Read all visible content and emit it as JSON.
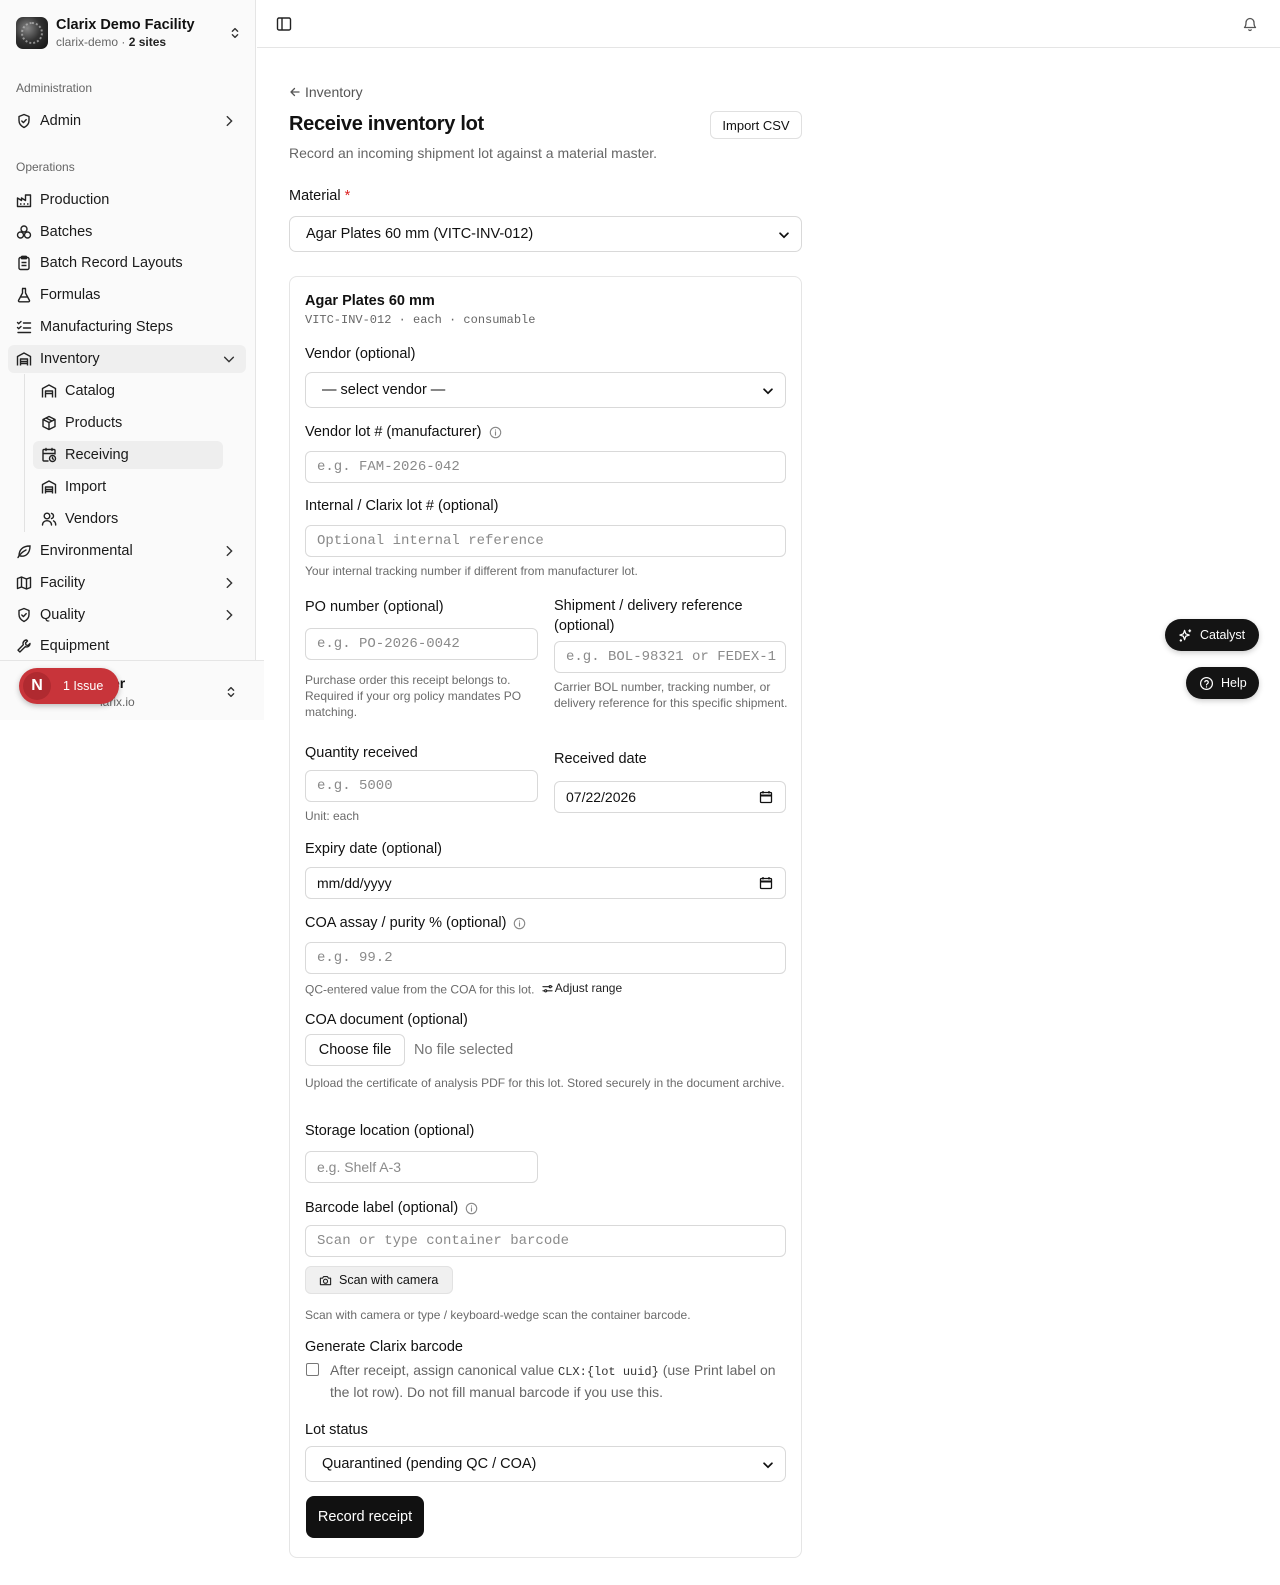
{
  "org": {
    "name": "Clarix Demo Facility",
    "slug": "clarix-demo",
    "sites": "2 sites"
  },
  "sidebar": {
    "admin_label": "Administration",
    "admin_item": "Admin",
    "ops_label": "Operations",
    "items": [
      "Production",
      "Batches",
      "Batch Record Layouts",
      "Formulas",
      "Manufacturing Steps",
      "Inventory",
      "Environmental",
      "Facility",
      "Quality",
      "Equipment"
    ],
    "inventory_sub": [
      "Catalog",
      "Products",
      "Receiving",
      "Import",
      "Vendors"
    ],
    "user_name": "er",
    "user_email": "larix.io"
  },
  "issue": {
    "initial": "N",
    "label": "1 Issue"
  },
  "page": {
    "back": "Inventory",
    "title": "Receive inventory lot",
    "subtitle": "Record an incoming shipment lot against a material master.",
    "import_button": "Import CSV"
  },
  "form": {
    "material_label": "Material",
    "material_required": "*",
    "material_value": "Agar Plates 60 mm (VITC-INV-012)",
    "material_name": "Agar Plates 60 mm",
    "material_meta": "VITC-INV-012 · each · consumable",
    "vendor_label": "Vendor (optional)",
    "vendor_value": "— select vendor —",
    "vendor_lot_label": "Vendor lot # (manufacturer)",
    "vendor_lot_placeholder": "e.g. FAM-2026-042",
    "internal_lot_label": "Internal / Clarix lot # (optional)",
    "internal_lot_placeholder": "Optional internal reference",
    "internal_lot_help": "Your internal tracking number if different from manufacturer lot.",
    "po_label": "PO number (optional)",
    "po_placeholder": "e.g. PO-2026-0042",
    "po_help": "Purchase order this receipt belongs to. Required if your org policy mandates PO matching.",
    "shipment_label": "Shipment / delivery reference (optional)",
    "shipment_placeholder": "e.g. BOL-98321 or FEDEX-1",
    "shipment_help": "Carrier BOL number, tracking number, or delivery reference for this specific shipment.",
    "quantity_label": "Quantity received",
    "quantity_placeholder": "e.g. 5000",
    "quantity_help": "Unit: each",
    "received_label": "Received date",
    "received_value": "07/22/2026",
    "expiry_label": "Expiry date (optional)",
    "expiry_value": "mm/dd/yyyy",
    "coa_label": "COA assay / purity % (optional)",
    "coa_placeholder": "e.g. 99.2",
    "coa_help": "QC-entered value from the COA for this lot.",
    "coa_adjust": "Adjust range",
    "coa_doc_label": "COA document (optional)",
    "choose_file": "Choose file",
    "no_file": "No file selected",
    "coa_doc_help": "Upload the certificate of analysis PDF for this lot. Stored securely in the document archive.",
    "storage_label": "Storage location (optional)",
    "storage_placeholder": "e.g. Shelf A-3",
    "barcode_label": "Barcode label (optional)",
    "barcode_placeholder": "Scan or type container barcode",
    "scan_button": "Scan with camera",
    "scan_help": "Scan with camera or type / keyboard-wedge scan the container barcode.",
    "generate_label": "Generate Clarix barcode",
    "generate_text_1": "After receipt, assign canonical value ",
    "generate_code": "CLX:{lot uuid}",
    "generate_text_2": " (use Print label on the lot row). Do not fill manual barcode if you use this.",
    "status_label": "Lot status",
    "status_value": "Quarantined (pending QC / COA)",
    "submit": "Record receipt"
  },
  "floating": {
    "catalyst": "Catalyst",
    "help": "Help"
  },
  "colors": {
    "primary": "#111111",
    "issue": "#c8343a",
    "required": "#dd2222"
  }
}
